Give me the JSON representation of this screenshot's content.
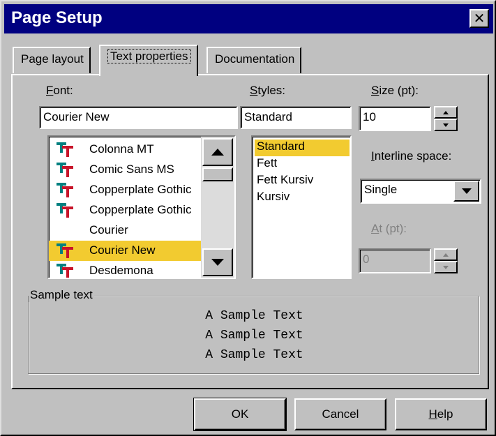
{
  "window": {
    "title": "Page Setup",
    "close_glyph": "✕"
  },
  "tabs": [
    {
      "label": "Page layout",
      "active": false
    },
    {
      "label": "Text properties",
      "active": true
    },
    {
      "label": "Documentation",
      "active": false
    }
  ],
  "font": {
    "label_mnemonic": "F",
    "label_rest": "ont:",
    "value": "Courier New",
    "items": [
      {
        "name": "Colonna MT",
        "truetype": true,
        "selected": false
      },
      {
        "name": "Comic Sans MS",
        "truetype": true,
        "selected": false
      },
      {
        "name": "Copperplate Gothic",
        "truetype": true,
        "selected": false
      },
      {
        "name": "Copperplate Gothic",
        "truetype": true,
        "selected": false
      },
      {
        "name": "Courier",
        "truetype": false,
        "selected": false
      },
      {
        "name": "Courier New",
        "truetype": true,
        "selected": true
      },
      {
        "name": "Desdemona",
        "truetype": true,
        "selected": false
      }
    ]
  },
  "styles": {
    "label_mnemonic": "S",
    "label_rest": "tyles:",
    "value": "Standard",
    "items": [
      {
        "name": "Standard",
        "selected": true
      },
      {
        "name": "Fett",
        "selected": false
      },
      {
        "name": "Fett Kursiv",
        "selected": false
      },
      {
        "name": "Kursiv",
        "selected": false
      }
    ]
  },
  "size": {
    "label_mnemonic": "S",
    "label_rest": "ize (pt):",
    "value": "10"
  },
  "interline": {
    "label_mnemonic": "I",
    "label_rest": "nterline space:",
    "value": "Single"
  },
  "at": {
    "label_mnemonic": "A",
    "label_rest": "t (pt):",
    "value": "0",
    "enabled": false
  },
  "sample": {
    "title": "Sample text",
    "lines": [
      "A Sample Text",
      "A Sample Text",
      "A Sample Text"
    ]
  },
  "buttons": {
    "ok": "OK",
    "cancel": "Cancel",
    "help_mnemonic": "H",
    "help_rest": "elp"
  },
  "colors": {
    "titlebar": "#000080",
    "face": "#c0c0c0",
    "selection": "#f2cb30",
    "tt_red": "#c8142a",
    "tt_teal": "#008080"
  }
}
